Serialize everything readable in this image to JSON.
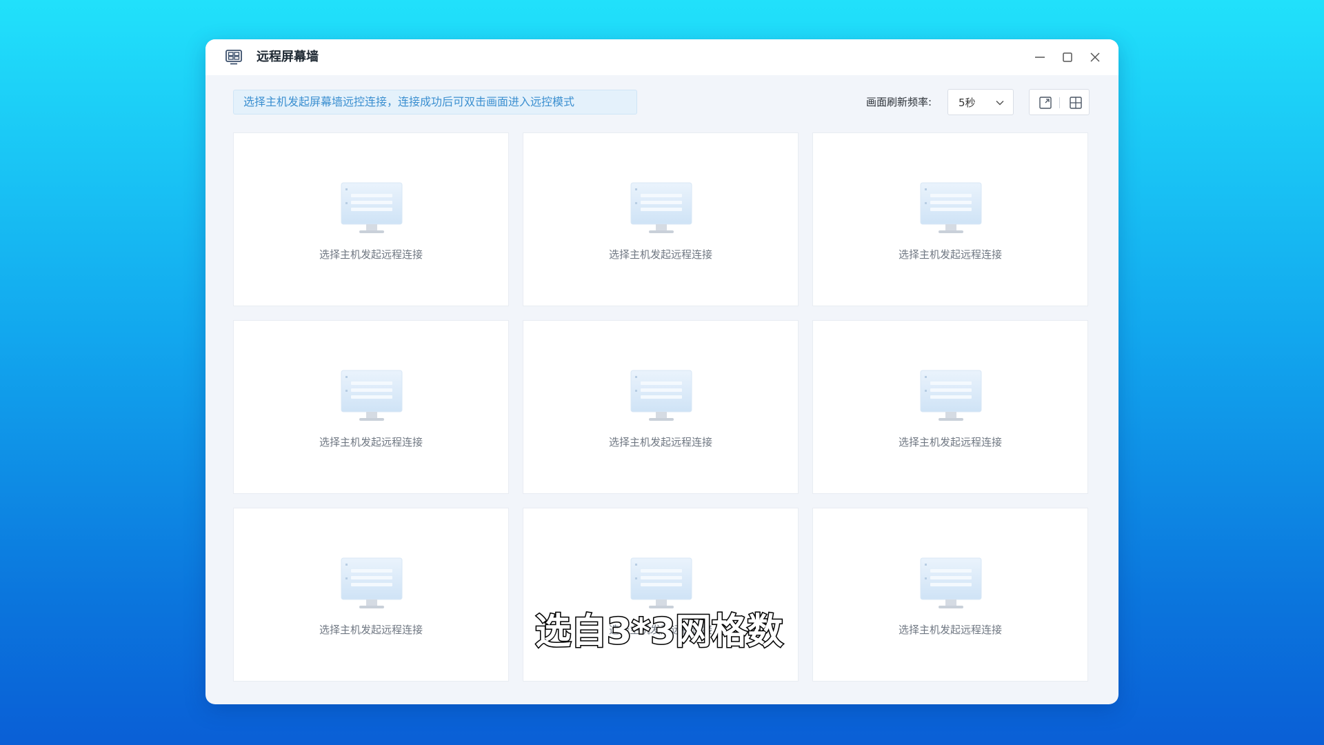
{
  "window": {
    "title": "远程屏幕墙"
  },
  "toolbar": {
    "notice": "选择主机发起屏幕墙远控连接，连接成功后可双击画面进入远控模式",
    "refresh_label": "画面刷新频率:",
    "refresh_value": "5秒"
  },
  "grid": {
    "cells": [
      {
        "label": "选择主机发起远程连接"
      },
      {
        "label": "选择主机发起远程连接"
      },
      {
        "label": "选择主机发起远程连接"
      },
      {
        "label": "选择主机发起远程连接"
      },
      {
        "label": "选择主机发起远程连接"
      },
      {
        "label": "选择主机发起远程连接"
      },
      {
        "label": "选择主机发起远程连接"
      },
      {
        "label": "选择主机发起远程连接"
      },
      {
        "label": "选择主机发起远程连接"
      }
    ]
  },
  "caption": "选自3*3网格数",
  "icons": {
    "app": "screen-wall-icon",
    "minimize": "minimize-icon",
    "maximize": "maximize-icon",
    "close": "close-icon",
    "dropdown": "chevron-down-icon",
    "layout_single": "single-screen-icon",
    "layout_grid": "grid-icon",
    "placeholder": "monitor-icon"
  },
  "colors": {
    "notice_text": "#3b8fd0",
    "notice_bg": "#e4f1fb",
    "window_bg": "#f2f5fa"
  }
}
